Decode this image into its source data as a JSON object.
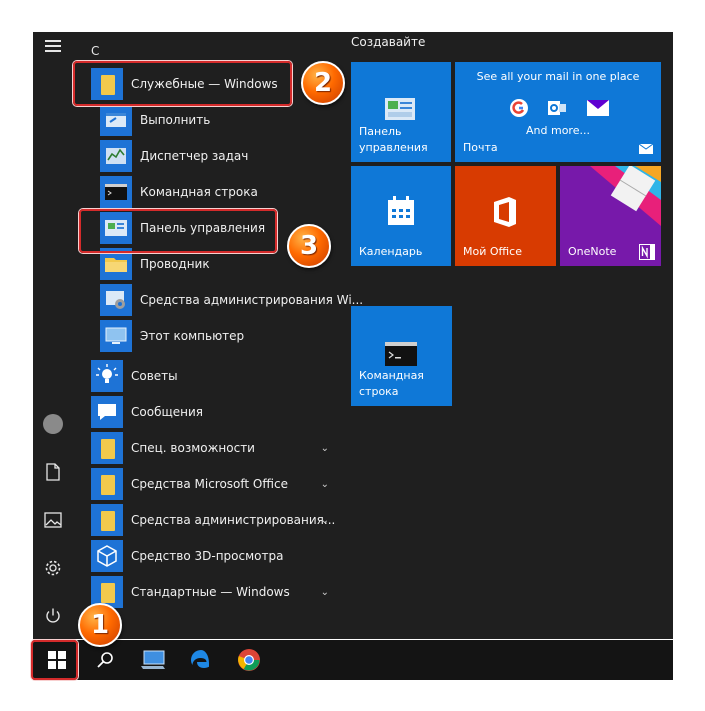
{
  "applist": {
    "letter": "С",
    "items": [
      {
        "label": "Служебные — Windows",
        "icon": "folder-icon",
        "chev": ""
      },
      {
        "label": "Выполнить",
        "icon": "run-icon",
        "chev": ""
      },
      {
        "label": "Диспетчер задач",
        "icon": "task-manager-icon",
        "chev": ""
      },
      {
        "label": "Командная строка",
        "icon": "cmd-icon",
        "chev": ""
      },
      {
        "label": "Панель управления",
        "icon": "control-panel-icon",
        "chev": ""
      },
      {
        "label": "Проводник",
        "icon": "explorer-icon",
        "chev": ""
      },
      {
        "label": "Средства администрирования Wi...",
        "icon": "admin-tools-icon",
        "chev": ""
      },
      {
        "label": "Этот компьютер",
        "icon": "this-pc-icon",
        "chev": ""
      },
      {
        "label": "Советы",
        "icon": "tips-icon",
        "chev": ""
      },
      {
        "label": "Сообщения",
        "icon": "messages-icon",
        "chev": ""
      },
      {
        "label": "Спец. возможности",
        "icon": "folder-icon",
        "chev": "⌄"
      },
      {
        "label": "Средства Microsoft Office",
        "icon": "folder-icon",
        "chev": "⌄"
      },
      {
        "label": "Средства администрирования...",
        "icon": "folder-icon",
        "chev": "⌄"
      },
      {
        "label": "Средство 3D-просмотра",
        "icon": "3d-viewer-icon",
        "chev": ""
      },
      {
        "label": "Стандартные — Windows",
        "icon": "folder-icon",
        "chev": "⌄"
      }
    ]
  },
  "tiles": {
    "group_title": "Создавайте",
    "control_panel": {
      "line1": "Панель",
      "line2": "управления"
    },
    "mail": {
      "headline": "See all your mail in one place",
      "more": "And more...",
      "label": "Почта"
    },
    "calendar": {
      "label": "Календарь"
    },
    "office": {
      "label": "Мой Office"
    },
    "onenote": {
      "label": "OneNote"
    },
    "cmd": {
      "line1": "Командная",
      "line2": "строка"
    }
  },
  "badges": {
    "one": "1",
    "two": "2",
    "three": "3"
  },
  "colors": {
    "tile_blue": "#0f78d7",
    "office_orange": "#d83b01",
    "onenote_purple": "#7719aa",
    "highlight_red": "#d42b2b",
    "badge_orange": "#ff6a00"
  }
}
